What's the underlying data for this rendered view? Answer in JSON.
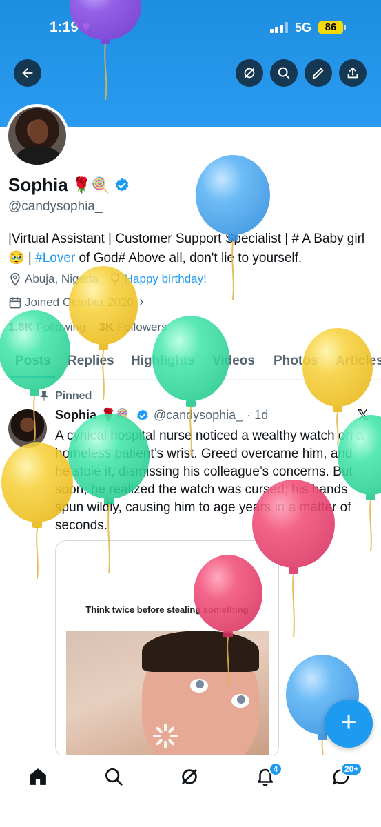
{
  "status_bar": {
    "time": "1:19",
    "network": "5G",
    "battery": "86"
  },
  "header": {
    "back_icon": "back-arrow-icon",
    "grok_icon": "grok-icon",
    "search_icon": "search-icon",
    "edit_icon": "pencil-icon",
    "share_icon": "share-icon"
  },
  "profile": {
    "name": "Sophia",
    "name_emojis": "🌹🍭",
    "handle": "@candysophia_",
    "bio_part1": "|Virtual Assistant | Customer Support Specialist | # A Baby girl 🥹 | ",
    "bio_tag": "#Lover",
    "bio_part2": " of God# Above all, don't lie to yourself.",
    "location": "Abuja, Nigeria",
    "birthday": "Happy birthday!",
    "joined": "Joined October 2020",
    "following_count": "1.8K",
    "following_label": "Following",
    "followers_count": "3K",
    "followers_label": "Followers"
  },
  "tabs": [
    "Posts",
    "Replies",
    "Highlights",
    "Videos",
    "Photos",
    "Articles"
  ],
  "post": {
    "pinned_label": "Pinned",
    "author": "Sophia",
    "author_emojis": "🌹🍭",
    "handle": "@candysophia_",
    "time": "· 1d",
    "text": "A cynical hospital nurse noticed a wealthy watch on a homeless patient’s wrist. Greed overcame him, and he stole it, dismissing his colleague’s concerns. But soon, he realized the watch was cursed; his hands spun wildly, causing him to age years in a matter of seconds.",
    "media_caption": "Think twice before stealing something"
  },
  "fab_label": "+",
  "bottom_nav": {
    "notifications_badge": "4",
    "messages_badge": "20+"
  },
  "colors": {
    "accent": "#1d9bf0",
    "banner": "#1e8ee0"
  }
}
